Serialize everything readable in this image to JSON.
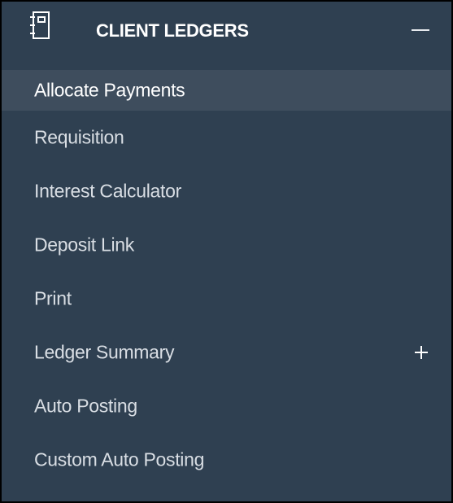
{
  "section": {
    "icon": "ledger-book-icon",
    "title": "CLIENT LEDGERS",
    "toggle_icon": "minus-icon"
  },
  "menu": {
    "items": [
      {
        "label": "Allocate Payments",
        "active": true
      },
      {
        "label": "Requisition"
      },
      {
        "label": "Interest Calculator"
      },
      {
        "label": "Deposit Link"
      },
      {
        "label": "Print"
      },
      {
        "label": "Ledger Summary",
        "icon": "plus-icon"
      },
      {
        "label": "Auto Posting"
      },
      {
        "label": "Custom Auto Posting"
      }
    ]
  },
  "colors": {
    "panel_background": "#2f4051",
    "active_item_background": "#3e4d5d",
    "text": "#d9dee4",
    "title_text": "#ffffff"
  }
}
